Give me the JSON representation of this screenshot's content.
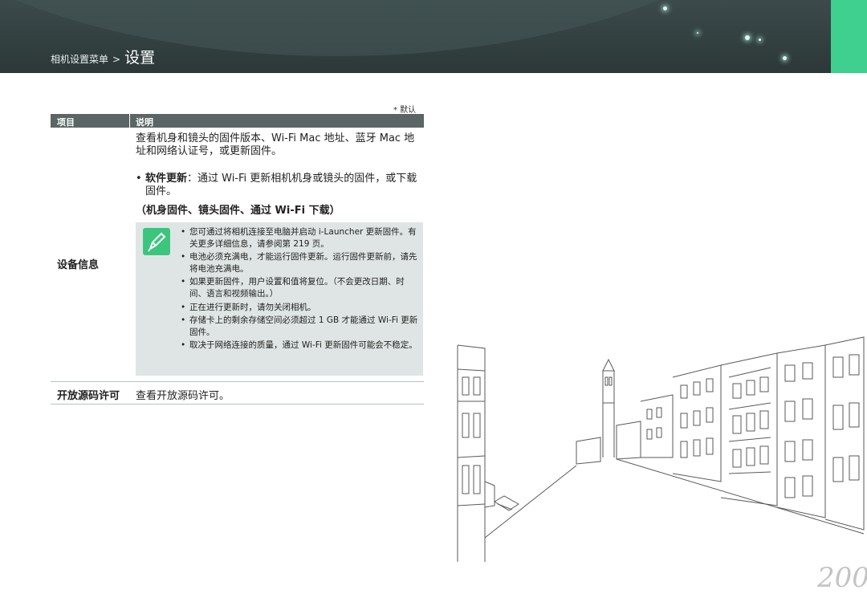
{
  "header": {
    "breadcrumb_sub": "相机设置菜单",
    "separator": ">",
    "title": "设置"
  },
  "default_note": "* 默认",
  "table": {
    "col_item": "项目",
    "col_desc": "说明",
    "row1": {
      "label": "设备信息",
      "desc": "查看机身和镜头的固件版本、Wi-Fi Mac 地址、蓝牙 Mac 地址和网络认证号，或更新固件。",
      "bullet_bold": "软件更新",
      "bullet_text": "：通过 Wi-Fi 更新相机机身或镜头的固件，或下载固件。",
      "bullet_sub": "（机身固件、镜头固件、通过 Wi-Fi 下载）",
      "notes": [
        "您可通过将相机连接至电脑并启动 i-Launcher 更新固件。有关更多详细信息，请参阅第 219 页。",
        "电池必须充满电，才能运行固件更新。运行固件更新前，请先将电池充满电。",
        "如果更新固件，用户设置和值将复位。（不会更改日期、时间、语言和视频输出。）",
        "正在进行更新时，请勿关闭相机。",
        "存储卡上的剩余存储空间必须超过 1 GB 才能通过 Wi-Fi 更新固件。",
        "取决于网络连接的质量，通过 Wi-Fi 更新固件可能会不稳定。"
      ]
    },
    "row2": {
      "label": "开放源码许可",
      "desc": "查看开放源码许可。"
    }
  },
  "page_number": "200",
  "icons": {
    "note": "pencil-note-icon",
    "bullet": "•"
  },
  "colors": {
    "header_bg": "#2f3b3b",
    "accent_green": "#3fcf8e",
    "table_header": "#5b6565",
    "note_bg": "#dfe5e4"
  }
}
